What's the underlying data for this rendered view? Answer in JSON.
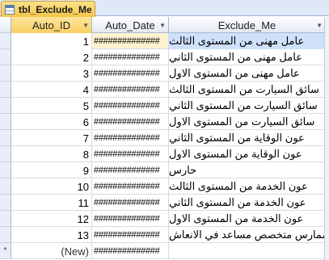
{
  "tab": {
    "title": "tbl_Exclude_Me",
    "icon": "table-icon"
  },
  "columns": [
    {
      "label": "Auto_ID",
      "sort_icon": "dropdown-arrow-icon"
    },
    {
      "label": "Auto_Date",
      "sort_icon": "dropdown-arrow-icon"
    },
    {
      "label": "Exclude_Me",
      "sort_icon": "dropdown-arrow-icon"
    }
  ],
  "new_record_marker": "*",
  "rows": [
    {
      "id": "1",
      "date": "##############",
      "exclude": "عامل مهنى من المستوى الثالث"
    },
    {
      "id": "2",
      "date": "##############",
      "exclude": "عامل مهنى من المستوى الثاني"
    },
    {
      "id": "3",
      "date": "##############",
      "exclude": "عامل مهنى من المستوى الاول"
    },
    {
      "id": "4",
      "date": "##############",
      "exclude": "سائق السيارت من المستوى الثالث"
    },
    {
      "id": "5",
      "date": "##############",
      "exclude": "سائق السيارت من المستوى الثاني"
    },
    {
      "id": "6",
      "date": "##############",
      "exclude": "سائق السيارت من المستوى الاول"
    },
    {
      "id": "7",
      "date": "##############",
      "exclude": "عون الوقاية من المستوى الثاني"
    },
    {
      "id": "8",
      "date": "##############",
      "exclude": "عون الوقاية من المستوى الاول"
    },
    {
      "id": "9",
      "date": "##############",
      "exclude": "حارس"
    },
    {
      "id": "10",
      "date": "##############",
      "exclude": "عون الخدمة من المستوى الثالث"
    },
    {
      "id": "11",
      "date": "##############",
      "exclude": "عون الخدمة من المستوى الثاني"
    },
    {
      "id": "12",
      "date": "##############",
      "exclude": "عون الخدمة من المستوى الاول"
    },
    {
      "id": "13",
      "date": "##############",
      "exclude": "ممارس متخصص مساعد في الانعاش"
    }
  ],
  "new_row": {
    "id": "(New)",
    "date": "##############",
    "exclude": ""
  }
}
